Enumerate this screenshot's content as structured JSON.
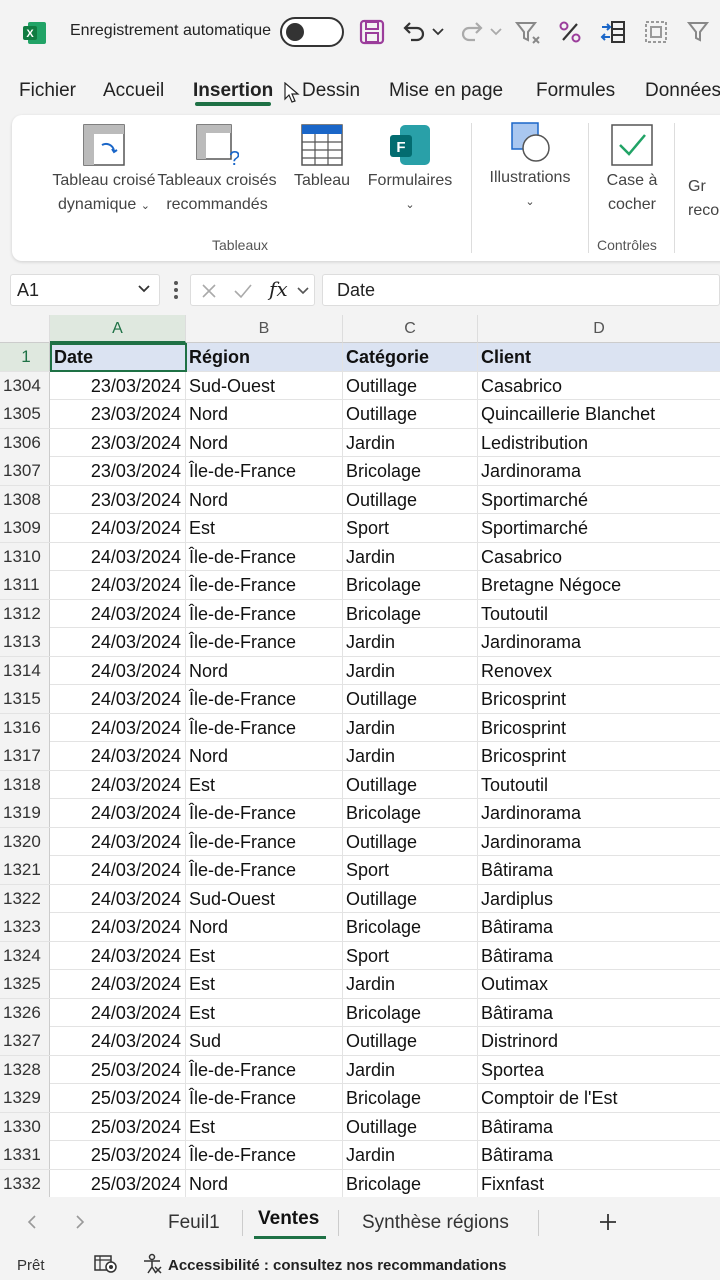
{
  "titlebar": {
    "autosave_label": "Enregistrement automatique",
    "autosave_on": false,
    "icons": [
      "excel-logo",
      "save-icon",
      "undo-icon",
      "redo-icon",
      "filter-icon",
      "percent-icon",
      "table-arrows-icon",
      "select-icon",
      "clear-filter-icon"
    ]
  },
  "tabs": [
    "Fichier",
    "Accueil",
    "Insertion",
    "Dessin",
    "Mise en page",
    "Formules",
    "Données"
  ],
  "active_tab": "Insertion",
  "ribbon": {
    "pivot_line1": "Tableau croisé",
    "pivot_line2": "dynamique",
    "recpivot_line1": "Tableaux croisés",
    "recpivot_line2": "recommandés",
    "table": "Tableau",
    "forms": "Formulaires",
    "illustrations": "Illustrations",
    "checkbox_line1": "Case à",
    "checkbox_line2": "cocher",
    "partial_line1": "Gr",
    "partial_line2": "reco",
    "group_tables": "Tableaux",
    "group_controls": "Contrôles"
  },
  "formula_bar": {
    "name_box": "A1",
    "content": "Date"
  },
  "columns": [
    "A",
    "B",
    "C",
    "D"
  ],
  "header_row": {
    "num": "1",
    "date": "Date",
    "region": "Région",
    "category": "Catégorie",
    "client": "Client"
  },
  "rows": [
    [
      "1304",
      "23/03/2024",
      "Sud-Ouest",
      "Outillage",
      "Casabrico"
    ],
    [
      "1305",
      "23/03/2024",
      "Nord",
      "Outillage",
      "Quincaillerie Blanchet"
    ],
    [
      "1306",
      "23/03/2024",
      "Nord",
      "Jardin",
      "Ledistribution"
    ],
    [
      "1307",
      "23/03/2024",
      "Île-de-France",
      "Bricolage",
      "Jardinorama"
    ],
    [
      "1308",
      "23/03/2024",
      "Nord",
      "Outillage",
      "Sportimarché"
    ],
    [
      "1309",
      "24/03/2024",
      "Est",
      "Sport",
      "Sportimarché"
    ],
    [
      "1310",
      "24/03/2024",
      "Île-de-France",
      "Jardin",
      "Casabrico"
    ],
    [
      "1311",
      "24/03/2024",
      "Île-de-France",
      "Bricolage",
      "Bretagne Négoce"
    ],
    [
      "1312",
      "24/03/2024",
      "Île-de-France",
      "Bricolage",
      "Toutoutil"
    ],
    [
      "1313",
      "24/03/2024",
      "Île-de-France",
      "Jardin",
      "Jardinorama"
    ],
    [
      "1314",
      "24/03/2024",
      "Nord",
      "Jardin",
      "Renovex"
    ],
    [
      "1315",
      "24/03/2024",
      "Île-de-France",
      "Outillage",
      "Bricosprint"
    ],
    [
      "1316",
      "24/03/2024",
      "Île-de-France",
      "Jardin",
      "Bricosprint"
    ],
    [
      "1317",
      "24/03/2024",
      "Nord",
      "Jardin",
      "Bricosprint"
    ],
    [
      "1318",
      "24/03/2024",
      "Est",
      "Outillage",
      "Toutoutil"
    ],
    [
      "1319",
      "24/03/2024",
      "Île-de-France",
      "Bricolage",
      "Jardinorama"
    ],
    [
      "1320",
      "24/03/2024",
      "Île-de-France",
      "Outillage",
      "Jardinorama"
    ],
    [
      "1321",
      "24/03/2024",
      "Île-de-France",
      "Sport",
      "Bâtirama"
    ],
    [
      "1322",
      "24/03/2024",
      "Sud-Ouest",
      "Outillage",
      "Jardiplus"
    ],
    [
      "1323",
      "24/03/2024",
      "Nord",
      "Bricolage",
      "Bâtirama"
    ],
    [
      "1324",
      "24/03/2024",
      "Est",
      "Sport",
      "Bâtirama"
    ],
    [
      "1325",
      "24/03/2024",
      "Est",
      "Jardin",
      "Outimax"
    ],
    [
      "1326",
      "24/03/2024",
      "Est",
      "Bricolage",
      "Bâtirama"
    ],
    [
      "1327",
      "24/03/2024",
      "Sud",
      "Outillage",
      "Distrinord"
    ],
    [
      "1328",
      "25/03/2024",
      "Île-de-France",
      "Jardin",
      "Sportea"
    ],
    [
      "1329",
      "25/03/2024",
      "Île-de-France",
      "Bricolage",
      "Comptoir de l'Est"
    ],
    [
      "1330",
      "25/03/2024",
      "Est",
      "Outillage",
      "Bâtirama"
    ],
    [
      "1331",
      "25/03/2024",
      "Île-de-France",
      "Jardin",
      "Bâtirama"
    ],
    [
      "1332",
      "25/03/2024",
      "Nord",
      "Bricolage",
      "Fixnfast"
    ]
  ],
  "sheets": [
    "Feuil1",
    "Ventes",
    "Synthèse régions"
  ],
  "active_sheet": "Ventes",
  "status": {
    "ready": "Prêt",
    "accessibility": "Accessibilité : consultez nos recommandations"
  },
  "colors": {
    "accent": "#1e7145",
    "header_row_bg": "#dbe3f2"
  }
}
